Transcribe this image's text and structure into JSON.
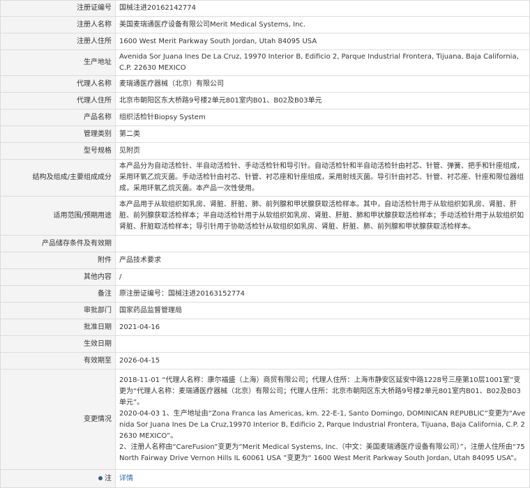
{
  "rows": [
    {
      "label": "注册证编号",
      "value": "国械注进20162142774"
    },
    {
      "label": "注册人名称",
      "value": "美国麦瑞通医疗设备有限公司Merit Medical Systems, Inc."
    },
    {
      "label": "注册人住所",
      "value": "1600 West Merit Parkway South Jordan, Utah 84095 USA"
    },
    {
      "label": "生产地址",
      "value": "Avenida Sor Juana Ines De La Cruz, 19970 Interior B, Edificio 2, Parque Industrial Frontera, Tijuana, Baja California, C.P. 22630 MEXICO"
    },
    {
      "label": "代理人名称",
      "value": "麦瑞通医疗器械（北京）有限公司"
    },
    {
      "label": "代理人住所",
      "value": "北京市朝阳区东大桥路9号楼2单元801室内B01、B02及B03单元"
    },
    {
      "label": "产品名称",
      "value": "组织活检针Biopsy System"
    },
    {
      "label": "管理类别",
      "value": "第二类"
    },
    {
      "label": "型号规格",
      "value": "见附页"
    },
    {
      "label": "结构及组成/主要组成成分",
      "value": "本产品分为自动活检针、半自动活检针、手动活检针和导引针。自动活检针和半自动活检针由衬芯、针管、弹簧、把手和针座组成，采用环氧乙烷灭菌。手动活检针由衬芯、针管、衬芯座和针座组成，采用射线灭菌。导引针由衬芯、针管、衬芯座、针座和限位器组成，采用环氧乙烷灭菌。本产品一次性使用。"
    },
    {
      "label": "适用范围/预期用途",
      "value": "本产品用于从软组织如乳房、肾脏、肝脏、肺、前列腺和甲状腺获取活检样本。其中，自动活检针用于从软组织如乳房、肾脏、肝脏、前列腺获取活检样本；半自动活检针用于从软组织如乳房、肾脏、肝脏、肺和甲状腺获取活检样本；手动活检针用于从软组织如肾脏、肝脏取活检样本；导引针用于协助活检针从软组织如乳房、肾脏、肝脏、肺、前列腺和甲状腺获取活检样本。"
    },
    {
      "label": "产品储存条件及有效期",
      "value": ""
    },
    {
      "label": "附件",
      "value": "产品技术要求"
    },
    {
      "label": "其他内容",
      "value": "/"
    },
    {
      "label": "备注",
      "value": "原注册证编号：国械注进20163152774"
    },
    {
      "label": "审批部门",
      "value": "国家药品监督管理局"
    },
    {
      "label": "批准日期",
      "value": "2021-04-16"
    },
    {
      "label": "生效日期",
      "value": ""
    },
    {
      "label": "有效期至",
      "value": "2026-04-15"
    }
  ],
  "changes": {
    "label": "变更情况",
    "line1": "2018-11-01 “代理人名称：康尔福盛（上海）商贸有限公司；代理人住所：上海市静安区延安中路1228号三座第10层1001室”变更为“代理人名称：麦瑞通医疗器械（北京）有限公司；代理人住所：北京市朝阳区东大桥路9号楼2单元801室内B01、B02及B03单元”。",
    "line2": "2020-04-03 1、生产地址由“Zona Franca las Americas, km. 22-E-1, Santo Domingo, DOMINICAN REPUBLIC”变更为“Avenida Sor Juana Ines De La Cruz,19970 Interior B, Edificio 2, Parque Industrial Frontera, Tijuana, Baja California, C.P. 22630 MEXICO”。",
    "line3": "2、注册人名称由“CareFusion”变更为“Merit Medical Systems, Inc.（中文：美国麦瑞通医疗设备有限公司）”，注册人住所由“75 North Fairway Drive Vernon Hills IL 60061 USA ”变更为“ 1600 West Merit Parkway South Jordan, Utah 84095 USA”。"
  },
  "note": {
    "label": "注",
    "icon": "pin-icon",
    "link": "详情"
  }
}
